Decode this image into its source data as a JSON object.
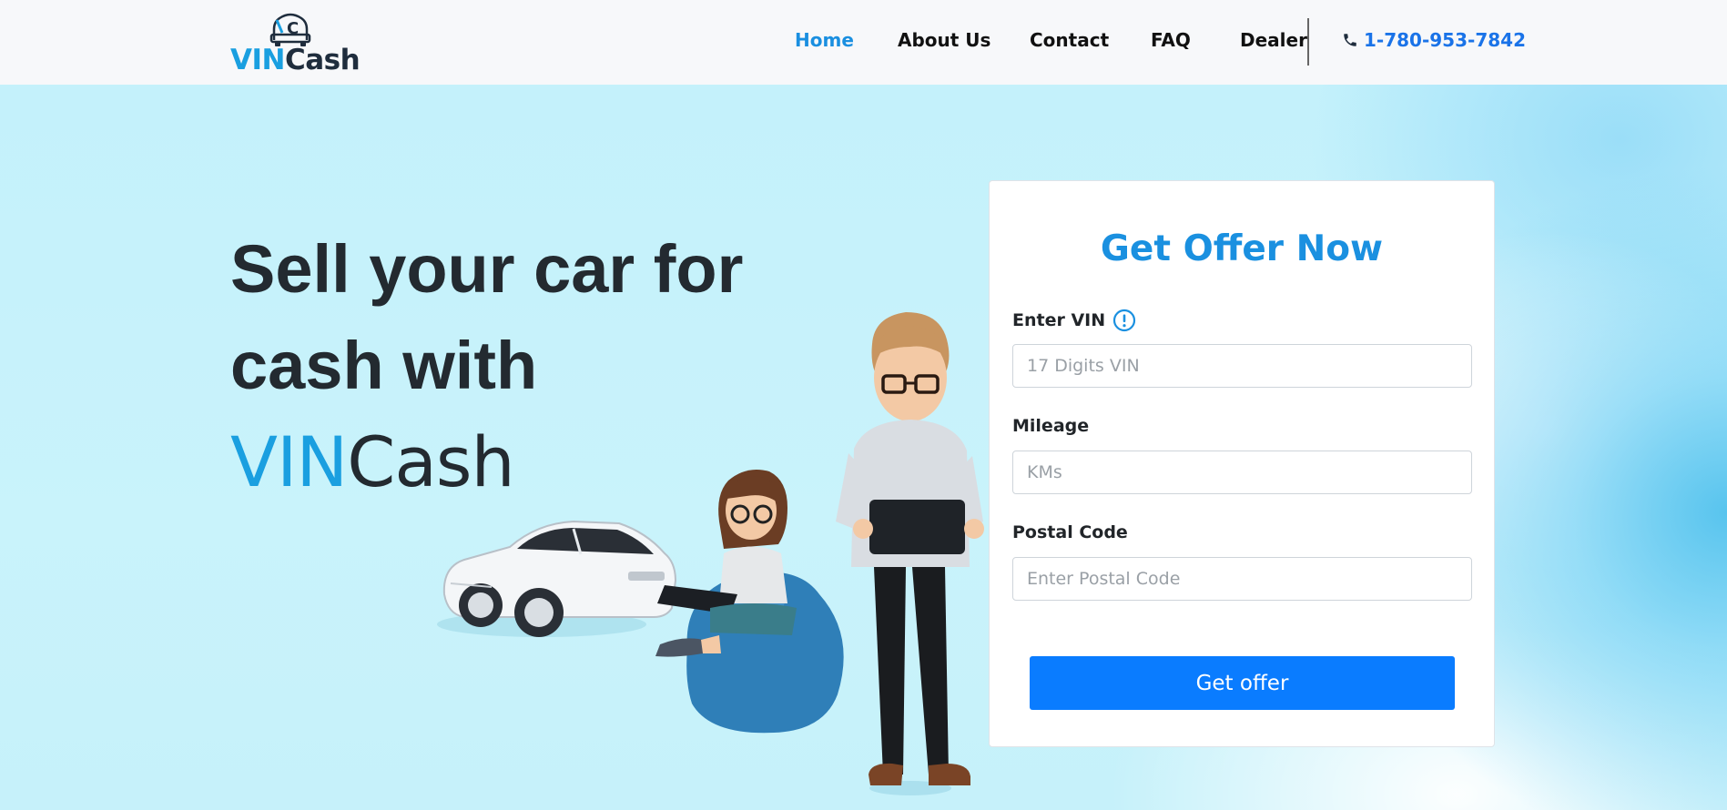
{
  "header": {
    "logo": {
      "vin": "VIN",
      "cash": "Cash",
      "mark": "C"
    },
    "nav": [
      {
        "label": "Home",
        "active": true
      },
      {
        "label": "About Us",
        "active": false
      },
      {
        "label": "Contact",
        "active": false
      },
      {
        "label": "FAQ",
        "active": false
      },
      {
        "label": "Dealer",
        "active": false
      }
    ],
    "phone": {
      "number": "1-780-953-7842",
      "icon": "phone-icon"
    }
  },
  "hero": {
    "headline_line1": "Sell your car for",
    "headline_line2": "cash with",
    "brand_vin": "VIN",
    "brand_cash": "Cash"
  },
  "form": {
    "title": "Get Offer Now",
    "vin_label": "Enter VIN",
    "vin_placeholder": "17 Digits VIN",
    "vin_value": "",
    "mileage_label": "Mileage",
    "mileage_placeholder": "KMs",
    "mileage_value": "",
    "postal_label": "Postal Code",
    "postal_placeholder": "Enter Postal Code",
    "postal_value": "",
    "submit_label": "Get offer"
  },
  "colors": {
    "accent": "#1a9fe0",
    "nav_active": "#1a8fe0",
    "phone": "#1a73e8",
    "button": "#0a7cff",
    "hero_bg": "#c4f1fb",
    "heading": "#232a30"
  }
}
